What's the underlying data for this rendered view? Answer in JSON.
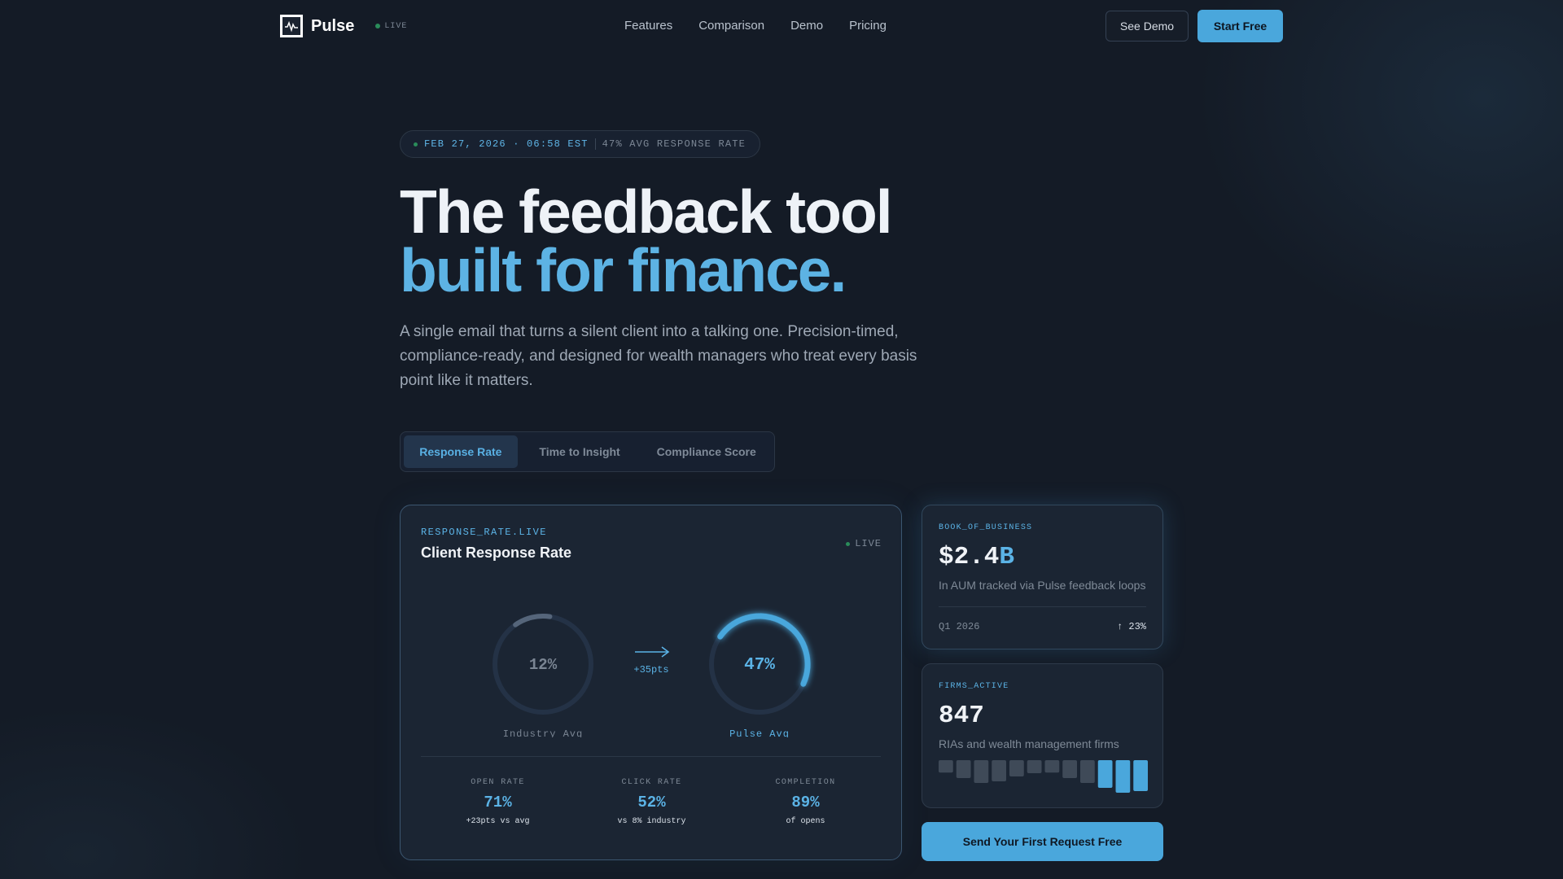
{
  "nav": {
    "brand": "Pulse",
    "live": "LIVE",
    "links": [
      "Features",
      "Comparison",
      "Demo",
      "Pricing"
    ],
    "see_demo": "See Demo",
    "start_free": "Start Free"
  },
  "ticker": {
    "datetime": "FEB 27, 2026 · 06:58 EST",
    "rate": "47% AVG RESPONSE RATE"
  },
  "hero": {
    "title_line1": "The feedback tool",
    "title_line2": "built for finance.",
    "subtitle": "A single email that turns a silent client into a talking one. Precision-timed, compliance-ready, and designed for wealth managers who treat every basis point like it matters."
  },
  "tabs": [
    "Response Rate",
    "Time to Insight",
    "Compliance Score"
  ],
  "main_card": {
    "label": "RESPONSE_RATE.LIVE",
    "title": "Client Response Rate",
    "live": "LIVE",
    "industry": {
      "value": "12%",
      "fraction": 0.12,
      "caption": "Industry Avg"
    },
    "pulse": {
      "value": "47%",
      "fraction": 0.47,
      "caption": "Pulse Avg"
    },
    "delta": "+35pts",
    "stats": [
      {
        "label": "OPEN RATE",
        "value": "71%",
        "note": "+23pts vs avg"
      },
      {
        "label": "CLICK RATE",
        "value": "52%",
        "note": "vs 8% industry"
      },
      {
        "label": "COMPLETION",
        "value": "89%",
        "note": "of opens"
      }
    ]
  },
  "aum_card": {
    "label": "BOOK_OF_BUSINESS",
    "value_main": "$2.4",
    "value_suffix": "B",
    "desc": "In AUM tracked via Pulse feedback loops",
    "period": "Q1 2026",
    "change": "↑ 23%"
  },
  "firms_card": {
    "label": "FIRMS_ACTIVE",
    "value": "847",
    "desc": "RIAs and wealth management firms",
    "bars": [
      0.38,
      0.55,
      0.7,
      0.65,
      0.5,
      0.4,
      0.38,
      0.55,
      0.7,
      0.85,
      1.0,
      0.95
    ],
    "highlight_from": 9
  },
  "cta": "Send Your First Request Free",
  "colors": {
    "accent": "#4aa7dc",
    "accent_text": "#5bb3e6",
    "live_dot": "#2fb56f",
    "bar_muted": "#3f4a58"
  }
}
